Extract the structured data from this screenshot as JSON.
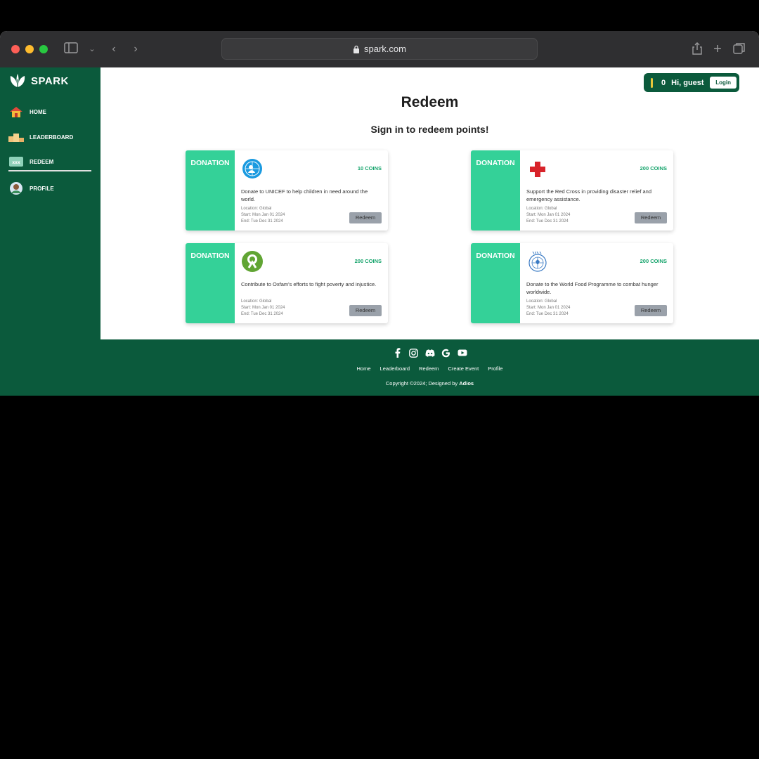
{
  "browser": {
    "url": "spark.com"
  },
  "brand": {
    "name": "SPARK"
  },
  "sidebar": {
    "items": [
      {
        "label": "HOME",
        "icon": "home-icon"
      },
      {
        "label": "LEADERBOARD",
        "icon": "podium-icon"
      },
      {
        "label": "REDEEM",
        "icon": "redeem-icon",
        "active": true
      },
      {
        "label": "PROFILE",
        "icon": "avatar-icon"
      }
    ]
  },
  "user": {
    "points": "0",
    "greeting": "Hi, guest",
    "login_label": "Login"
  },
  "page": {
    "title": "Redeem",
    "subtitle": "Sign in to redeem points!"
  },
  "cards": [
    {
      "tag": "DONATION",
      "coins": "10 COINS",
      "logo": "unicef-icon",
      "description": "Donate to UNICEF to help children in need around the world.",
      "location": "Location: Global",
      "start": "Start: Mon Jan 01 2024",
      "end": "End: Tue Dec 31 2024",
      "button": "Redeem"
    },
    {
      "tag": "DONATION",
      "coins": "200 COINS",
      "logo": "red-cross-icon",
      "description": "Support the Red Cross in providing disaster relief and emergency assistance.",
      "location": "Location: Global",
      "start": "Start: Mon Jan 01 2024",
      "end": "End: Tue Dec 31 2024",
      "button": "Redeem"
    },
    {
      "tag": "DONATION",
      "coins": "200 COINS",
      "logo": "oxfam-icon",
      "description": "Contribute to Oxfam's efforts to fight poverty and injustice.",
      "location": "Location: Global",
      "start": "Start: Mon Jan 01 2024",
      "end": "End: Tue Dec 31 2024",
      "button": "Redeem"
    },
    {
      "tag": "DONATION",
      "coins": "200 COINS",
      "logo": "wfp-icon",
      "description": "Donate to the World Food Programme to combat hunger worldwide.",
      "location": "Location: Global",
      "start": "Start: Mon Jan 01 2024",
      "end": "End: Tue Dec 31 2024",
      "button": "Redeem"
    }
  ],
  "footer": {
    "socials": [
      "facebook-icon",
      "instagram-icon",
      "discord-icon",
      "google-icon",
      "youtube-icon"
    ],
    "links": [
      "Home",
      "Leaderboard",
      "Redeem",
      "Create Event",
      "Profile"
    ],
    "copyright_prefix": "Copyright ©2024; Designed by",
    "designer": "Adios"
  },
  "colors": {
    "primary": "#0b5a3c",
    "accent": "#34d198",
    "coins": "#16a46c"
  }
}
